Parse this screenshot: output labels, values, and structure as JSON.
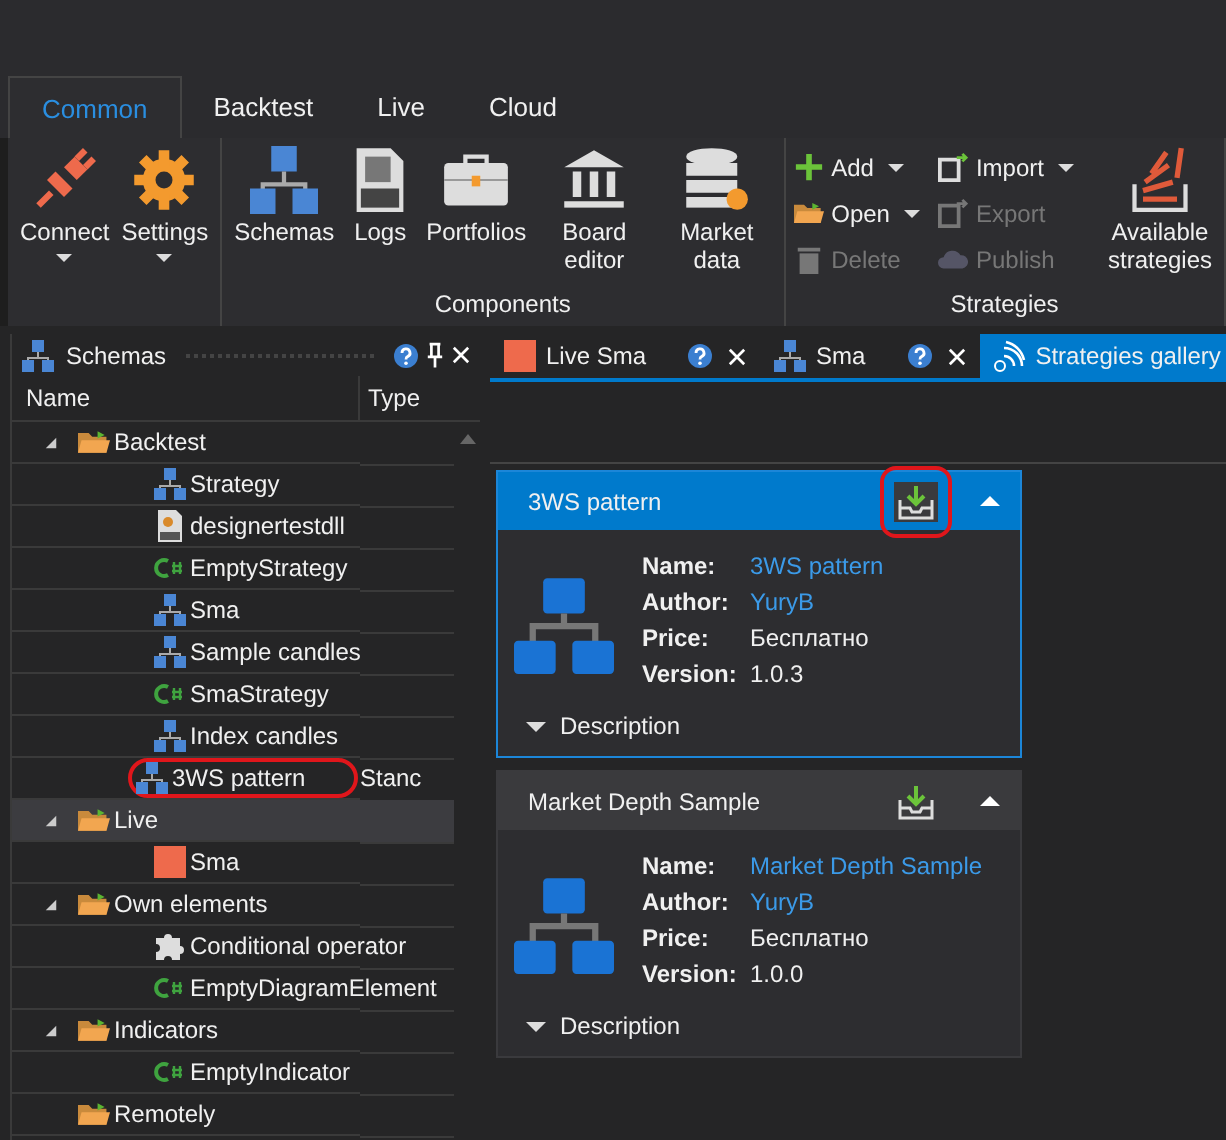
{
  "ribbon_tabs": [
    {
      "label": "Common",
      "selected": true
    },
    {
      "label": "Backtest",
      "selected": false
    },
    {
      "label": "Live",
      "selected": false
    },
    {
      "label": "Cloud",
      "selected": false
    }
  ],
  "ribbon_groups": [
    {
      "buttons": [
        {
          "kind": "large",
          "label": "Connect",
          "dropdown": true
        },
        {
          "kind": "large",
          "label": "Settings",
          "dropdown": true
        }
      ]
    },
    {
      "label": "Components",
      "buttons": [
        {
          "kind": "large",
          "label": "Schemas",
          "dropdown": false
        },
        {
          "kind": "large",
          "label": "Logs",
          "dropdown": false
        },
        {
          "kind": "large",
          "label": "Portfolios",
          "dropdown": false
        },
        {
          "kind": "large",
          "label": "Board editor",
          "dropdown": false
        },
        {
          "kind": "large",
          "label": "Market data",
          "dropdown": false
        }
      ]
    },
    {
      "label": "Strategies",
      "buttons": [
        {
          "kind": "small",
          "label": "Add",
          "dropdown": true,
          "disabled": false
        },
        {
          "kind": "small",
          "label": "Open",
          "dropdown": true,
          "disabled": false
        },
        {
          "kind": "small",
          "label": "Delete",
          "dropdown": false,
          "disabled": true
        },
        {
          "kind": "small",
          "label": "Import",
          "dropdown": true,
          "disabled": false
        },
        {
          "kind": "small",
          "label": "Export",
          "dropdown": false,
          "disabled": true
        },
        {
          "kind": "small",
          "label": "Publish",
          "dropdown": false,
          "disabled": true
        },
        {
          "kind": "large",
          "label": "Available strategies",
          "dropdown": false
        }
      ]
    }
  ],
  "schemas_panel": {
    "title": "Schemas",
    "columns": [
      "Name",
      "Type"
    ],
    "tree": [
      {
        "label": "Backtest",
        "kind": "folder",
        "expanded": true,
        "selected": false,
        "children": [
          {
            "label": "Strategy",
            "kind": "schema",
            "selected": false
          },
          {
            "label": "designertestdll",
            "kind": "dll",
            "selected": false
          },
          {
            "label": "EmptyStrategy",
            "kind": "csharp",
            "selected": false
          },
          {
            "label": "Sma",
            "kind": "schema",
            "selected": false
          },
          {
            "label": "Sample candles",
            "kind": "schema",
            "selected": false
          },
          {
            "label": "SmaStrategy",
            "kind": "csharp",
            "selected": false
          },
          {
            "label": "Index candles",
            "kind": "schema",
            "selected": false
          },
          {
            "label": "3WS pattern",
            "kind": "schema",
            "selected": false,
            "type": "Stanc",
            "circled": true
          }
        ]
      },
      {
        "label": "Live",
        "kind": "folder",
        "expanded": true,
        "selected": true,
        "children": [
          {
            "label": "Sma",
            "kind": "live",
            "selected": false
          }
        ]
      },
      {
        "label": "Own elements",
        "kind": "folder",
        "expanded": true,
        "selected": false,
        "children": [
          {
            "label": "Conditional operator",
            "kind": "puzzle",
            "selected": false
          },
          {
            "label": "EmptyDiagramElement",
            "kind": "csharp",
            "selected": false
          }
        ]
      },
      {
        "label": "Indicators",
        "kind": "folder",
        "expanded": true,
        "selected": false,
        "children": [
          {
            "label": "EmptyIndicator",
            "kind": "csharp",
            "selected": false
          }
        ]
      },
      {
        "label": "Remotely",
        "kind": "folder",
        "selected": false
      }
    ]
  },
  "doc_tabs": [
    {
      "label": "Live Sma",
      "kind": "live",
      "selected": false
    },
    {
      "label": "Sma",
      "kind": "schema",
      "selected": false
    },
    {
      "label": "Strategies gallery",
      "kind": "signal",
      "selected": true
    }
  ],
  "gallery": [
    {
      "title": "3WS pattern",
      "selected": true,
      "circled": true,
      "fields": [
        {
          "label": "Name:",
          "value": "3WS pattern",
          "kind": "link"
        },
        {
          "label": "Author:",
          "value": "YuryB",
          "kind": "link"
        },
        {
          "label": "Price:",
          "value": "Бесплатно",
          "kind": "text"
        },
        {
          "label": "Version:",
          "value": "1.0.3",
          "kind": "text"
        }
      ],
      "description": "Description"
    },
    {
      "title": "Market Depth Sample",
      "selected": false,
      "circled": false,
      "fields": [
        {
          "label": "Name:",
          "value": "Market Depth Sample",
          "kind": "link"
        },
        {
          "label": "Author:",
          "value": "YuryB",
          "kind": "link"
        },
        {
          "label": "Price:",
          "value": "Бесплатно",
          "kind": "text"
        },
        {
          "label": "Version:",
          "value": "1.0.0",
          "kind": "text"
        }
      ],
      "description": "Description"
    }
  ]
}
